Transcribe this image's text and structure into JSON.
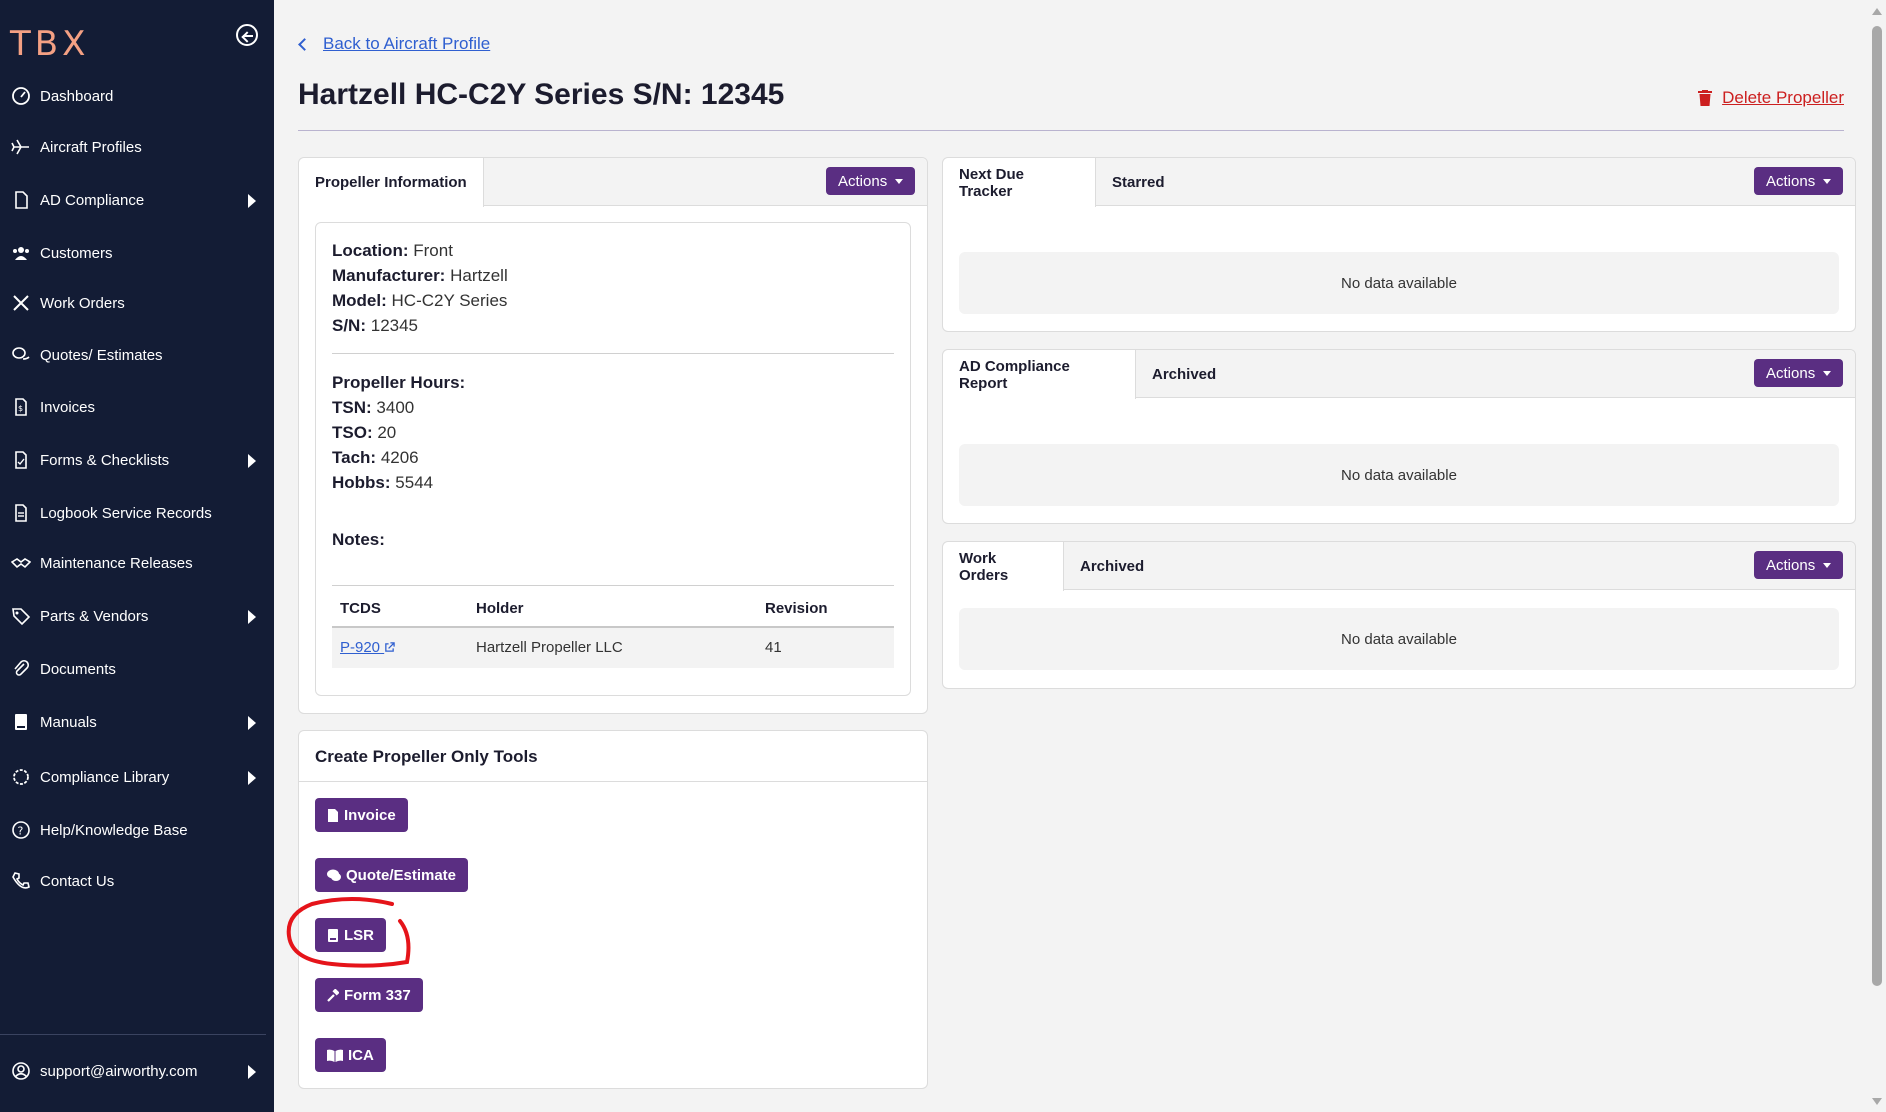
{
  "app": {
    "logo": "TBX"
  },
  "sidebar": {
    "items": [
      {
        "label": "Dashboard",
        "icon": "dashboard-icon"
      },
      {
        "label": "Aircraft Profiles",
        "icon": "airplane-icon"
      },
      {
        "label": "AD Compliance",
        "icon": "file-icon",
        "expandable": true
      },
      {
        "label": "Customers",
        "icon": "users-icon"
      },
      {
        "label": "Work Orders",
        "icon": "tools-icon"
      },
      {
        "label": "Quotes/ Estimates",
        "icon": "chat-icon"
      },
      {
        "label": "Invoices",
        "icon": "invoice-icon"
      },
      {
        "label": "Forms & Checklists",
        "icon": "form-icon",
        "expandable": true
      },
      {
        "label": "Logbook Service Records",
        "icon": "logbook-icon"
      },
      {
        "label": "Maintenance Releases",
        "icon": "handshake-icon"
      },
      {
        "label": "Parts & Vendors",
        "icon": "tag-icon",
        "expandable": true
      },
      {
        "label": "Documents",
        "icon": "paperclip-icon"
      },
      {
        "label": "Manuals",
        "icon": "book-icon",
        "expandable": true
      },
      {
        "label": "Compliance Library",
        "icon": "badge-icon",
        "expandable": true
      },
      {
        "label": "Help/Knowledge Base",
        "icon": "help-icon"
      },
      {
        "label": "Contact Us",
        "icon": "phone-icon"
      }
    ],
    "user": {
      "label": "support@airworthy.com",
      "icon": "user-circle-icon"
    }
  },
  "header": {
    "back_label": "Back to Aircraft Profile",
    "title": "Hartzell HC-C2Y Series S/N: 12345",
    "delete_label": "Delete Propeller"
  },
  "propeller_card": {
    "tab": "Propeller Information",
    "actions_label": "Actions",
    "location_label": "Location:",
    "location": "Front",
    "manufacturer_label": "Manufacturer:",
    "manufacturer": "Hartzell",
    "model_label": "Model:",
    "model": "HC-C2Y Series",
    "sn_label": "S/N:",
    "sn": "12345",
    "hours_label": "Propeller Hours:",
    "tsn_label": "TSN:",
    "tsn": "3400",
    "tso_label": "TSO:",
    "tso": "20",
    "tach_label": "Tach:",
    "tach": "4206",
    "hobbs_label": "Hobbs:",
    "hobbs": "5544",
    "notes_label": "Notes:",
    "table": {
      "headers": [
        "TCDS",
        "Holder",
        "Revision"
      ],
      "rows": [
        {
          "tcds": "P-920",
          "holder": "Hartzell Propeller LLC",
          "revision": "41"
        }
      ]
    }
  },
  "tools_card": {
    "title": "Create Propeller Only Tools",
    "buttons": [
      {
        "label": "Invoice",
        "icon": "invoice-icon"
      },
      {
        "label": "Quote/Estimate",
        "icon": "chat-icon"
      },
      {
        "label": "LSR",
        "icon": "logbook-icon"
      },
      {
        "label": "Form 337",
        "icon": "hammer-icon"
      },
      {
        "label": "ICA",
        "icon": "open-book-icon"
      }
    ]
  },
  "next_due_card": {
    "tabs": [
      "Next Due Tracker",
      "Starred"
    ],
    "actions_label": "Actions",
    "empty_text": "No data available"
  },
  "ad_card": {
    "tabs": [
      "AD Compliance Report",
      "Archived"
    ],
    "actions_label": "Actions",
    "empty_text": "No data available"
  },
  "wo_card": {
    "tabs": [
      "Work Orders",
      "Archived"
    ],
    "actions_label": "Actions",
    "empty_text": "No data available"
  },
  "colors": {
    "sidebar_bg": "#131c35",
    "accent": "#5a2e82",
    "link": "#2f5fd0",
    "danger": "#cc1f1f",
    "annotation": "#e5141a"
  }
}
